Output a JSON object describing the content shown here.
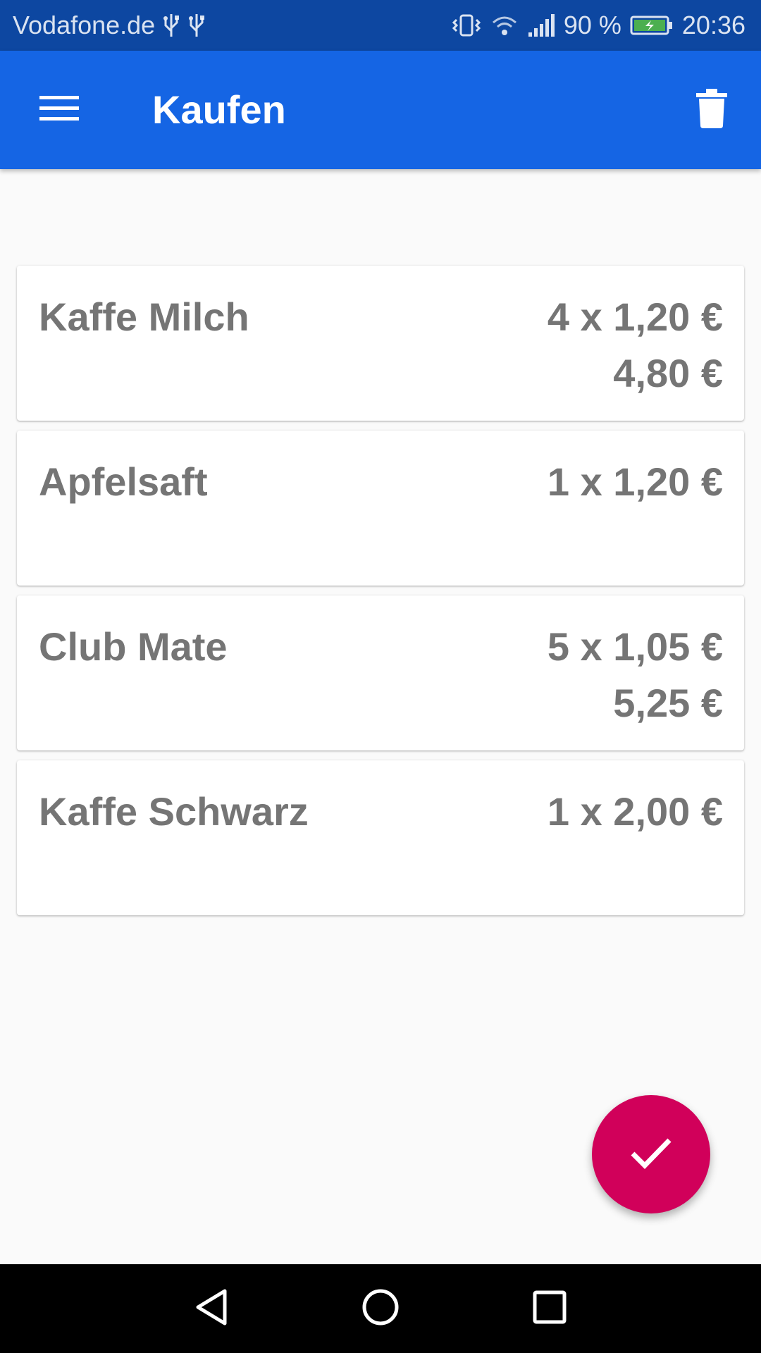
{
  "status_bar": {
    "carrier": "Vodafone.de",
    "battery": "90 %",
    "time": "20:36",
    "icons": [
      "usb-icon",
      "usb-icon",
      "vibrate-icon",
      "wifi-icon",
      "signal-icon",
      "battery-charging-icon"
    ]
  },
  "app_bar": {
    "title": "Kaufen",
    "menu_icon": "menu-icon",
    "delete_icon": "trash-icon",
    "color": "#1565e4"
  },
  "items": [
    {
      "name": "Kaffe Milch",
      "quantity_price": "4 x 1,20 €",
      "total": "4,80 €"
    },
    {
      "name": "Apfelsaft",
      "quantity_price": "1 x 1,20 €",
      "total": ""
    },
    {
      "name": "Club Mate",
      "quantity_price": "5 x 1,05 €",
      "total": "5,25 €"
    },
    {
      "name": "Kaffe Schwarz",
      "quantity_price": "1 x 2,00 €",
      "total": ""
    }
  ],
  "fab": {
    "icon": "check-icon",
    "color": "#d1005a"
  },
  "nav_bar": {
    "icons": [
      "back-icon",
      "home-icon",
      "recents-icon"
    ]
  }
}
